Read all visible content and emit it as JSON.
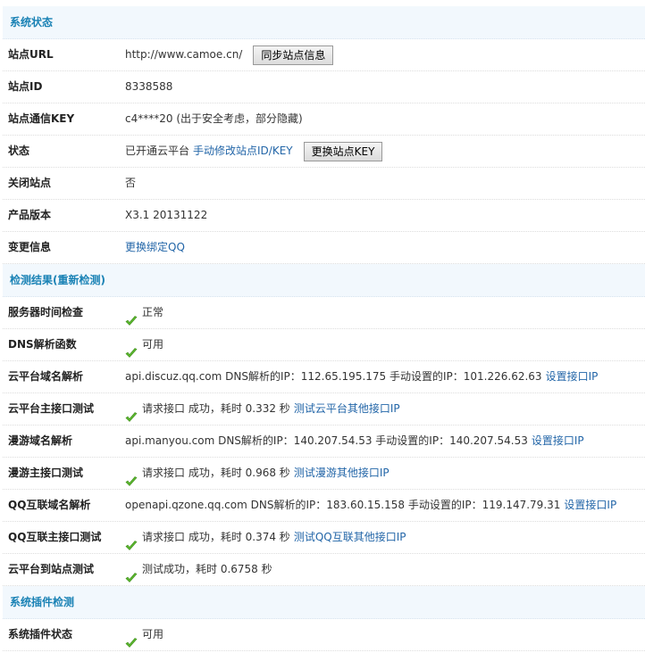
{
  "sections": [
    {
      "title": "系统状态"
    },
    {
      "title": "检测结果",
      "recheck": "(重新检测)"
    },
    {
      "title": "系统插件检测"
    }
  ],
  "status": {
    "url_label": "站点URL",
    "url": "http://www.camoe.cn/",
    "sync_button": "同步站点信息",
    "id_label": "站点ID",
    "id": "8338588",
    "key_label": "站点通信KEY",
    "key": "c4****20 (出于安全考虑，部分隐藏)",
    "state_label": "状态",
    "state": "已开通云平台",
    "state_link": "手动修改站点ID/KEY",
    "change_key_button": "更换站点KEY",
    "closed_label": "关闭站点",
    "closed": "否",
    "version_label": "产品版本",
    "version": "X3.1 20131122",
    "change_label": "变更信息",
    "change_link": "更换绑定QQ"
  },
  "checks": [
    {
      "label": "服务器时间检查",
      "ok": true,
      "text": "正常",
      "link": ""
    },
    {
      "label": "DNS解析函数",
      "ok": true,
      "text": "可用",
      "link": ""
    },
    {
      "label": "云平台域名解析",
      "ok": false,
      "text": "api.discuz.qq.com DNS解析的IP：112.65.195.175 手动设置的IP：101.226.62.63",
      "link": "设置接口IP"
    },
    {
      "label": "云平台主接口测试",
      "ok": true,
      "text": "请求接口 成功，耗时 0.332 秒",
      "link": "测试云平台其他接口IP"
    },
    {
      "label": "漫游域名解析",
      "ok": false,
      "text": "api.manyou.com DNS解析的IP：140.207.54.53 手动设置的IP：140.207.54.53",
      "link": "设置接口IP"
    },
    {
      "label": "漫游主接口测试",
      "ok": true,
      "text": "请求接口 成功，耗时 0.968 秒",
      "link": "测试漫游其他接口IP"
    },
    {
      "label": "QQ互联域名解析",
      "ok": false,
      "text": "openapi.qzone.qq.com DNS解析的IP：183.60.15.158 手动设置的IP：119.147.79.31",
      "link": "设置接口IP"
    },
    {
      "label": "QQ互联主接口测试",
      "ok": true,
      "text": "请求接口 成功，耗时 0.374 秒",
      "link": "测试QQ互联其他接口IP"
    },
    {
      "label": "云平台到站点测试",
      "ok": true,
      "text": "测试成功，耗时 0.6758 秒",
      "link": ""
    }
  ],
  "plugins": [
    {
      "label": "系统插件状态",
      "ok": true,
      "text": "可用"
    }
  ]
}
